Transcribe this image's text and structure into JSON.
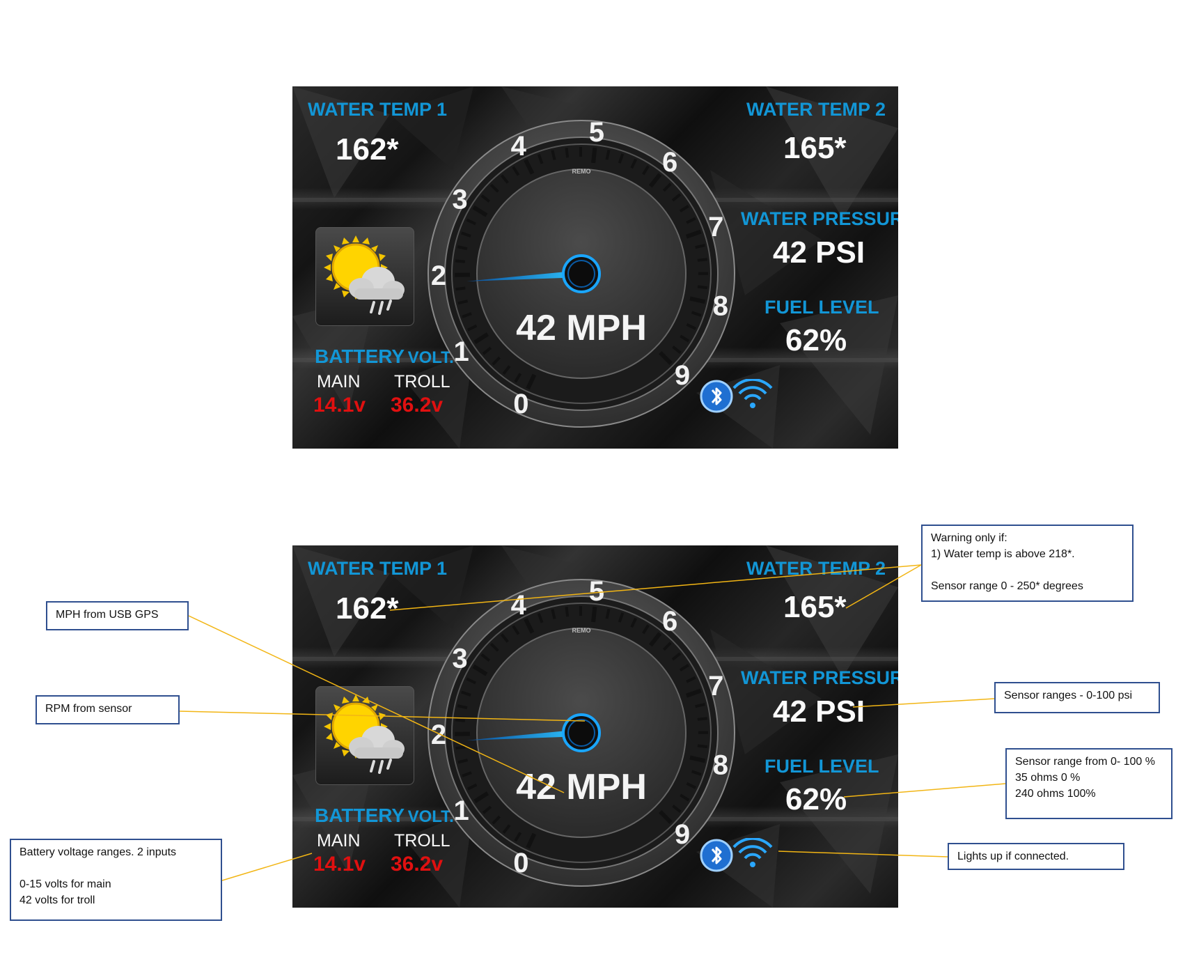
{
  "dashboards": [
    {
      "water_temp_1_label": "WATER TEMP 1",
      "water_temp_1_value": "162*",
      "water_temp_2_label": "WATER TEMP 2",
      "water_temp_2_value": "165*",
      "water_pressure_label": "WATER PRESSURE",
      "water_pressure_value": "42 PSI",
      "fuel_level_label": "FUEL LEVEL",
      "fuel_level_value": "62%",
      "battery_label_main": "BATTERY",
      "battery_label_suffix": "VOLT.",
      "battery_main_label": "MAIN",
      "battery_troll_label": "TROLL",
      "battery_main_value": "14.1v",
      "battery_troll_value": "36.2v",
      "speed_text": "42 MPH",
      "gauge_brand": "REMO",
      "gauge_ticks": [
        "0",
        "1",
        "2",
        "3",
        "4",
        "5",
        "6",
        "7",
        "8",
        "9"
      ],
      "tach_needle_value": 1.9,
      "weather_icon": "partly-cloudy-rain-icon",
      "bluetooth_icon": "bluetooth-icon",
      "wifi_icon": "wifi-icon"
    },
    {
      "water_temp_1_label": "WATER TEMP 1",
      "water_temp_1_value": "162*",
      "water_temp_2_label": "WATER TEMP 2",
      "water_temp_2_value": "165*",
      "water_pressure_label": "WATER PRESSURE",
      "water_pressure_value": "42 PSI",
      "fuel_level_label": "FUEL LEVEL",
      "fuel_level_value": "62%",
      "battery_label_main": "BATTERY",
      "battery_label_suffix": "VOLT.",
      "battery_main_label": "MAIN",
      "battery_troll_label": "TROLL",
      "battery_main_value": "14.1v",
      "battery_troll_value": "36.2v",
      "speed_text": "42 MPH",
      "gauge_brand": "REMO",
      "gauge_ticks": [
        "0",
        "1",
        "2",
        "3",
        "4",
        "5",
        "6",
        "7",
        "8",
        "9"
      ],
      "tach_needle_value": 1.9,
      "weather_icon": "partly-cloudy-rain-icon",
      "bluetooth_icon": "bluetooth-icon",
      "wifi_icon": "wifi-icon"
    }
  ],
  "annotations": {
    "mph_note": "MPH from USB GPS",
    "rpm_note": "RPM from sensor",
    "battery_note": "Battery voltage ranges. 2 inputs\n\n0-15 volts for main\n42 volts for troll",
    "warning_note": "Warning only if:\n1) Water temp is above 218*.\n\n Sensor range 0 - 250* degrees",
    "pressure_note": "Sensor ranges - 0-100 psi",
    "fuel_note": "Sensor range from 0- 100 %\n35 ohms 0 %\n240 ohms 100%",
    "connection_note": "Lights up if connected."
  },
  "colors": {
    "label_blue": "#1296d6",
    "value_white": "#fafafa",
    "battery_red": "#e01010",
    "leader_line": "#f2b514",
    "note_border": "#2f4f8f",
    "needle_cyan": "#18a8ff"
  }
}
